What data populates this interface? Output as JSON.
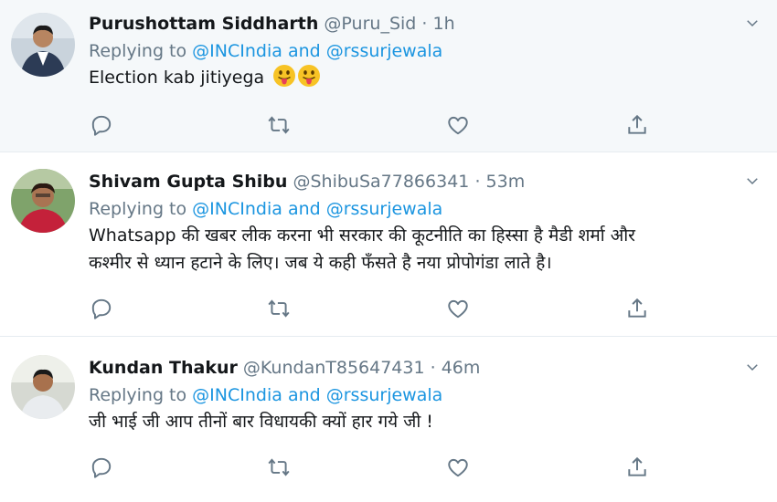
{
  "tweets": [
    {
      "name": "Purushottam Siddharth",
      "handle": "@Puru_Sid",
      "dot": "·",
      "time": "1h",
      "reply_prefix": "Replying to",
      "mention1": "@INCIndia",
      "and": "and",
      "mention2": "@rssurjewala",
      "text": "Election kab jitiyega",
      "emoji": [
        "tongue-out-emoji",
        "tongue-out-emoji"
      ]
    },
    {
      "name": "Shivam Gupta Shibu",
      "handle": "@ShibuSa77866341",
      "dot": "·",
      "time": "53m",
      "reply_prefix": "Replying to",
      "mention1": "@INCIndia",
      "and": "and",
      "mention2": "@rssurjewala",
      "text_line1": "Whatsapp की खबर लीक करना भी सरकार की कूटनीति का हिस्सा है मैडी शर्मा और",
      "text_line2": "कश्मीर से ध्यान हटाने के लिए। जब ये कही फँसते है नया प्रोपोगंडा लाते है।"
    },
    {
      "name": "Kundan Thakur",
      "handle": "@KundanT85647431",
      "dot": "·",
      "time": "46m",
      "reply_prefix": "Replying to",
      "mention1": "@INCIndia",
      "and": "and",
      "mention2": "@rssurjewala",
      "text": "जी भाई जी आप तीनों बार विधायकी क्यों हार गये जी !"
    }
  ],
  "icons": {
    "reply": "reply-icon",
    "retweet": "retweet-icon",
    "like": "like-icon",
    "share": "share-icon",
    "more": "chevron-down-icon"
  },
  "colors": {
    "mention": "#1b95e0",
    "meta": "#657786",
    "highlight_bg": "#f5f8fa"
  }
}
